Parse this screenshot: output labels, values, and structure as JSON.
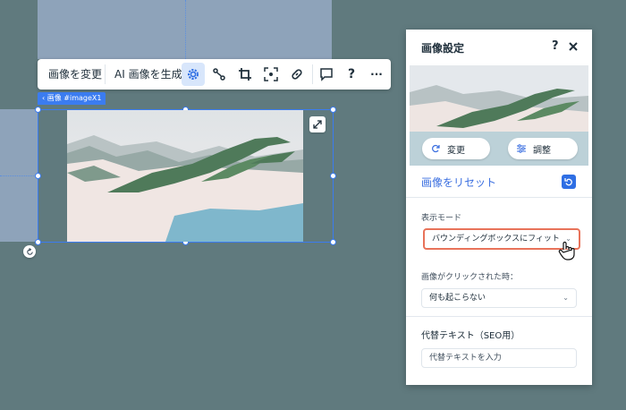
{
  "toolbar": {
    "change_image": "画像を変更",
    "ai_generate": "AI 画像を生成",
    "icons": [
      "settings-icon",
      "animation-icon",
      "crop-icon",
      "focus-icon",
      "link-icon",
      "comment-icon",
      "help-icon",
      "more-icon"
    ],
    "help_label": "?",
    "more_label": "···"
  },
  "selection": {
    "tag": "‹ 画像 #imageX1"
  },
  "panel": {
    "title": "画像設定",
    "help": "?",
    "preview_buttons": {
      "change": "変更",
      "adjust": "調整"
    },
    "reset_label": "画像をリセット",
    "display_mode_label": "表示モード",
    "display_mode_value": "バウンディングボックスにフィット",
    "on_click_label": "画像がクリックされた時：",
    "on_click_value": "何も起こらない",
    "alt_text_title": "代替テキスト（SEO用）",
    "alt_text_placeholder": "代替テキストを入力"
  },
  "colors": {
    "canvas": "#607a7e",
    "accent": "#3b7cf0",
    "highlight": "#e8735a"
  }
}
